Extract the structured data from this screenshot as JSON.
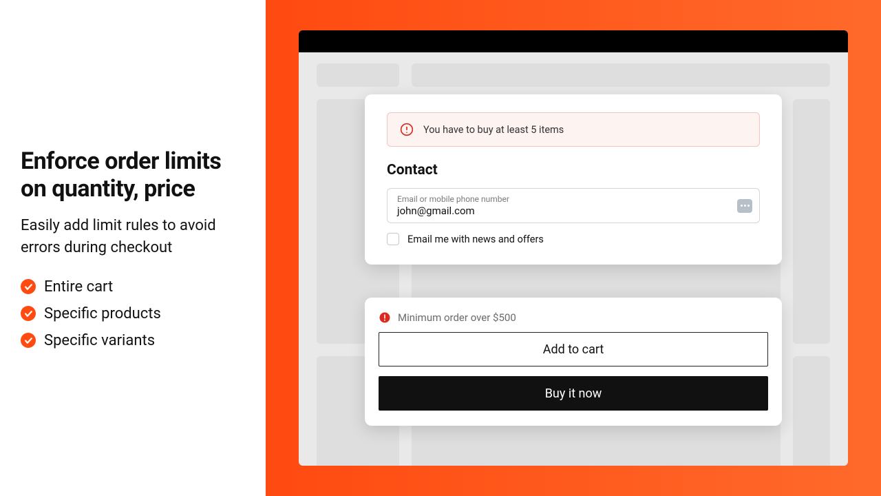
{
  "left": {
    "headline": "Enforce order limits on quantity, price",
    "subline": "Easily add limit rules to avoid errors during checkout",
    "features": [
      "Entire cart",
      "Specific products",
      "Specific variants"
    ]
  },
  "card1": {
    "alert": "You have to buy at least 5 items",
    "contact_heading": "Contact",
    "email_label": "Email or mobile phone number",
    "email_value": "john@gmail.com",
    "news_checkbox_label": "Email me with news and offers"
  },
  "card2": {
    "warning": "Minimum order over $500",
    "add_to_cart": "Add to cart",
    "buy_now": "Buy it now"
  },
  "colors": {
    "accent": "#ff4a11"
  }
}
